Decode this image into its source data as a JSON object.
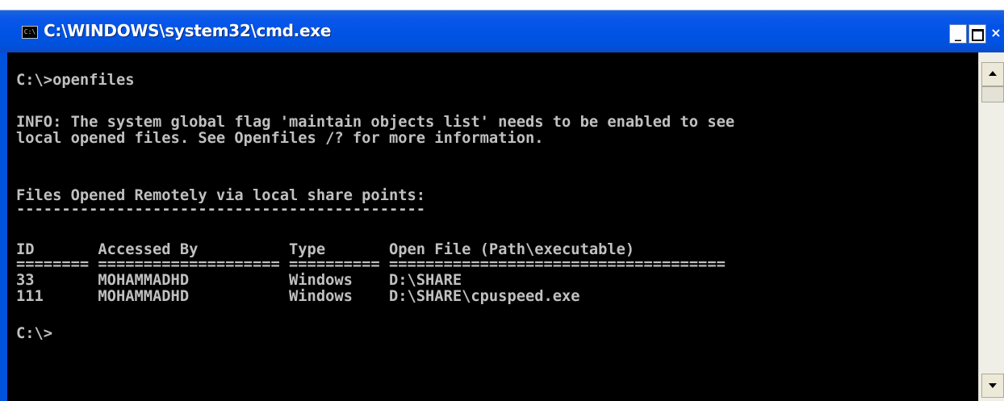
{
  "window": {
    "title": "C:\\WINDOWS\\system32\\cmd.exe",
    "icon_text": "C:\\",
    "buttons": {
      "minimize": "_",
      "close": "×"
    }
  },
  "console": {
    "lines": [
      "C:\\>openfiles",
      "",
      "INFO: The system global flag 'maintain objects list' needs to be enabled to see",
      "local opened files. See Openfiles /? for more information.",
      "",
      "",
      "Files Opened Remotely via local share points:",
      "---------------------------------------------",
      "",
      "ID       Accessed By          Type       Open File (Path\\executable)",
      "======== ==================== ========== =====================================",
      "33       MOHAMMADHD           Windows    D:\\SHARE",
      "111      MOHAMMADHD           Windows    D:\\SHARE\\cpuspeed.exe",
      "",
      "C:\\>"
    ]
  },
  "colors": {
    "title_bar": "#0054e3",
    "console_bg": "#000000",
    "console_text": "#c0c0c0"
  }
}
